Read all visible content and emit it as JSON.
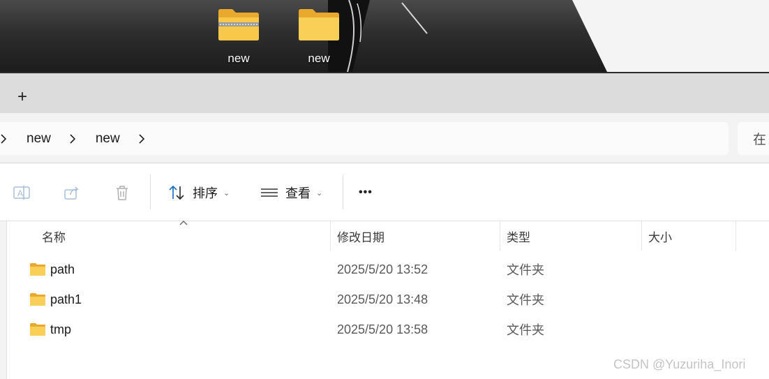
{
  "desktop": {
    "icons": [
      {
        "label": "new",
        "kind": "zip-folder-icon"
      },
      {
        "label": "new",
        "kind": "folder-icon"
      }
    ]
  },
  "tabbar": {
    "new_tab_glyph": "+"
  },
  "address": {
    "crumbs": [
      "new",
      "new"
    ],
    "search_glyph": "在"
  },
  "toolbar": {
    "sort_label": "排序",
    "view_label": "查看",
    "more_glyph": "•••"
  },
  "columns": {
    "name": "名称",
    "modified": "修改日期",
    "type": "类型",
    "size": "大小"
  },
  "files": [
    {
      "name": "path",
      "modified": "2025/5/20 13:52",
      "type": "文件夹",
      "size": ""
    },
    {
      "name": "path1",
      "modified": "2025/5/20 13:48",
      "type": "文件夹",
      "size": ""
    },
    {
      "name": "tmp",
      "modified": "2025/5/20 13:58",
      "type": "文件夹",
      "size": ""
    }
  ],
  "watermark": "CSDN @Yuzuriha_Inori",
  "colors": {
    "folder_yellow": "#f8c84a",
    "accent_blue": "#1f6fc5"
  }
}
